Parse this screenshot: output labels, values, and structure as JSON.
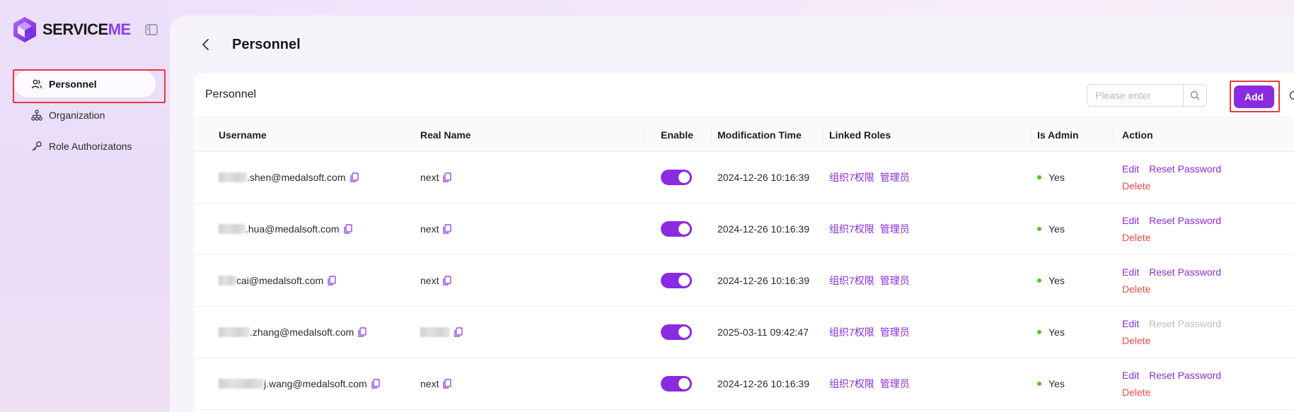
{
  "app": {
    "logo_main": "SERVICE",
    "logo_accent": "ME"
  },
  "sidebar": {
    "items": [
      {
        "label": "Personnel",
        "icon": "users-icon",
        "active": true
      },
      {
        "label": "Organization",
        "icon": "org-tree-icon",
        "active": false
      },
      {
        "label": "Role Authorizatons",
        "icon": "key-icon",
        "active": false
      }
    ]
  },
  "header": {
    "title": "Personnel"
  },
  "card": {
    "title": "Personnel",
    "search_placeholder": "Please enter",
    "add_label": "Add"
  },
  "table": {
    "columns": [
      "Username",
      "Real Name",
      "Enable",
      "Modification Time",
      "Linked Roles",
      "Is Admin",
      "Action"
    ],
    "rows": [
      {
        "username": ".shen@medalsoft.com",
        "real_name": "next",
        "enabled": true,
        "time": "2024-12-26 10:16:39",
        "roles": [
          "组织7权限",
          "管理员"
        ],
        "is_admin": "Yes",
        "edit": "Edit",
        "reset": "Reset Password",
        "reset_disabled": false,
        "delete": "Delete"
      },
      {
        "username": ".hua@medalsoft.com",
        "real_name": "next",
        "enabled": true,
        "time": "2024-12-26 10:16:39",
        "roles": [
          "组织7权限",
          "管理员"
        ],
        "is_admin": "Yes",
        "edit": "Edit",
        "reset": "Reset Password",
        "reset_disabled": false,
        "delete": "Delete"
      },
      {
        "username": "cai@medalsoft.com",
        "real_name": "next",
        "enabled": true,
        "time": "2024-12-26 10:16:39",
        "roles": [
          "组织7权限",
          "管理员"
        ],
        "is_admin": "Yes",
        "edit": "Edit",
        "reset": "Reset Password",
        "reset_disabled": false,
        "delete": "Delete"
      },
      {
        "username": ".zhang@medalsoft.com",
        "real_name": "",
        "enabled": true,
        "time": "2025-03-11 09:42:47",
        "roles": [
          "组织7权限",
          "管理员"
        ],
        "is_admin": "Yes",
        "edit": "Edit",
        "reset": "Reset Password",
        "reset_disabled": true,
        "delete": "Delete"
      },
      {
        "username": "j.wang@medalsoft.com",
        "real_name": "next",
        "enabled": true,
        "time": "2024-12-26 10:16:39",
        "roles": [
          "组织7权限",
          "管理员"
        ],
        "is_admin": "Yes",
        "edit": "Edit",
        "reset": "Reset Password",
        "reset_disabled": false,
        "delete": "Delete"
      }
    ]
  },
  "colors": {
    "accent": "#8a2be2",
    "danger": "#f04848",
    "success": "#52c41a",
    "highlight_box": "#e23b3b"
  }
}
